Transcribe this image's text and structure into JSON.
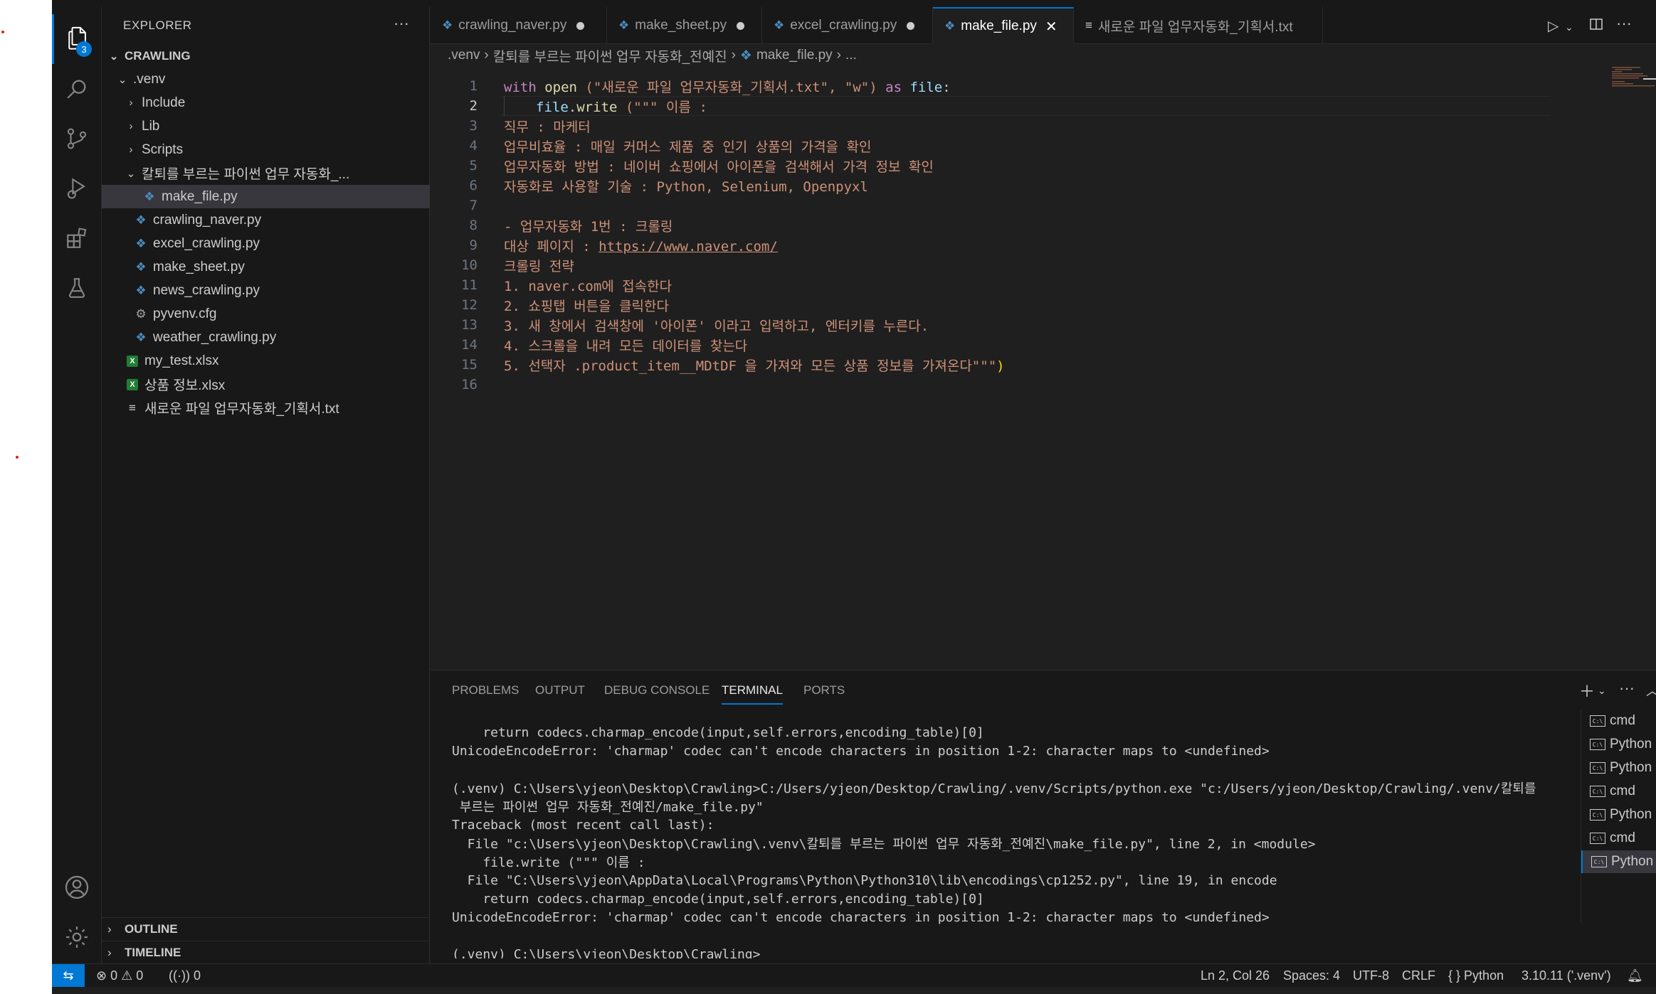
{
  "colors": {
    "accent": "#0078d4",
    "string": "#ce9178",
    "keyword": "#c586c0",
    "function": "#dcdcaa",
    "variable": "#9cdcfe"
  },
  "activity": {
    "explorer_icon": "files-icon",
    "explorer_badge": "3",
    "search_icon": "search-icon",
    "scm_icon": "source-control-icon",
    "debug_icon": "run-debug-icon",
    "extensions_icon": "extensions-icon",
    "testing_icon": "testing-flask-icon",
    "account_icon": "account-icon",
    "settings_icon": "gear-icon"
  },
  "sidebar": {
    "title": "EXPLORER",
    "more": "···",
    "root": "CRAWLING",
    "tree": [
      {
        "label": ".venv",
        "type": "folder-open"
      },
      {
        "label": "Include",
        "type": "folder"
      },
      {
        "label": "Lib",
        "type": "folder"
      },
      {
        "label": "Scripts",
        "type": "folder"
      },
      {
        "label": "칼퇴를 부르는 파이썬 업무 자동화_...",
        "type": "folder-open"
      },
      {
        "label": "make_file.py",
        "type": "python"
      },
      {
        "label": "crawling_naver.py",
        "type": "python"
      },
      {
        "label": "excel_crawling.py",
        "type": "python"
      },
      {
        "label": "make_sheet.py",
        "type": "python"
      },
      {
        "label": "news_crawling.py",
        "type": "python"
      },
      {
        "label": "pyvenv.cfg",
        "type": "config"
      },
      {
        "label": "weather_crawling.py",
        "type": "python"
      },
      {
        "label": "my_test.xlsx",
        "type": "excel"
      },
      {
        "label": "상품 정보.xlsx",
        "type": "excel"
      },
      {
        "label": "새로운 파일 업무자동화_기획서.txt",
        "type": "text"
      }
    ],
    "outline": "OUTLINE",
    "timeline": "TIMELINE"
  },
  "tabs": [
    {
      "label": "crawling_naver.py",
      "state": "modified"
    },
    {
      "label": "make_sheet.py",
      "state": "modified"
    },
    {
      "label": "excel_crawling.py",
      "state": "modified"
    },
    {
      "label": "make_file.py",
      "state": "active"
    },
    {
      "label": "새로운 파일 업무자동화_기획서.txt",
      "state": "normal"
    }
  ],
  "breadcrumb": [
    ".venv",
    "칼퇴를 부르는 파이썬 업무 자동화_전예진",
    "make_file.py",
    "..."
  ],
  "editor": {
    "current_line": 2,
    "lines": [
      {
        "n": "1"
      },
      {
        "n": "2"
      },
      {
        "n": "3"
      },
      {
        "n": "4"
      },
      {
        "n": "5"
      },
      {
        "n": "6"
      },
      {
        "n": "7"
      },
      {
        "n": "8"
      },
      {
        "n": "9"
      },
      {
        "n": "10"
      },
      {
        "n": "11"
      },
      {
        "n": "12"
      },
      {
        "n": "13"
      },
      {
        "n": "14"
      },
      {
        "n": "15"
      },
      {
        "n": "16"
      }
    ],
    "l1": {
      "with": "with",
      "open": "open",
      "args1": " (\"새로운 파일 업무자동화_기획서.txt\", \"w\") ",
      "as": "as",
      "file": "file",
      "colon": ":"
    },
    "l2": {
      "file": "file",
      "dot": ".",
      "write": "write",
      "rest": " (\"\"\" 이름 :"
    },
    "l3": "직무 : 마케터",
    "l4": "업무비효율 : 매일 커머스 제품 중 인기 상품의 가격을 확인",
    "l5": "업무자동화 방법 : 네이버 쇼핑에서 아이폰을 검색해서 가격 정보 확인",
    "l6": "자동화로 사용할 기술 : Python, Selenium, Openpyxl",
    "l7": "",
    "l8": "- 업무자동화 1번 : 크롤링",
    "l9_prefix": "대상 페이지 : ",
    "l9_link": "https://www.naver.com/",
    "l10": "크롤링 전략",
    "l11": "1. naver.com에 접속한다",
    "l12": "2. 쇼핑탭 버튼을 클릭한다",
    "l13": "3. 새 창에서 검색창에 '아이폰' 이라고 입력하고, 엔터키를 누른다.",
    "l14": "4. 스크롤을 내려 모든 데이터를 찾는다",
    "l15_str": "5. 선택자 .product_item__MDtDF 을 가져와 모든 상품 정보를 가져온다\"\"\"",
    "l15_end": ")",
    "l16": ""
  },
  "panel": {
    "tabs": [
      "PROBLEMS",
      "OUTPUT",
      "DEBUG CONSOLE",
      "TERMINAL",
      "PORTS"
    ],
    "active_tab": "TERMINAL",
    "terminal_lines": [
      "    return codecs.charmap_encode(input,self.errors,encoding_table)[0]",
      "UnicodeEncodeError: 'charmap' codec can't encode characters in position 1-2: character maps to <undefined>",
      "",
      "(.venv) C:\\Users\\yjeon\\Desktop\\Crawling>C:/Users/yjeon/Desktop/Crawling/.venv/Scripts/python.exe \"c:/Users/yjeon/Desktop/Crawling/.venv/칼퇴를",
      " 부르는 파이썬 업무 자동화_전예진/make_file.py\"",
      "Traceback (most recent call last):",
      "  File \"c:\\Users\\yjeon\\Desktop\\Crawling\\.venv\\칼퇴를 부르는 파이썬 업무 자동화_전예진\\make_file.py\", line 2, in <module>",
      "    file.write (\"\"\" 이름 :",
      "  File \"C:\\Users\\yjeon\\AppData\\Local\\Programs\\Python\\Python310\\lib\\encodings\\cp1252.py\", line 19, in encode",
      "    return codecs.charmap_encode(input,self.errors,encoding_table)[0]",
      "UnicodeEncodeError: 'charmap' codec can't encode characters in position 1-2: character maps to <undefined>",
      "",
      "(.venv) C:\\Users\\yjeon\\Desktop\\Crawling>"
    ],
    "terminals": [
      {
        "label": "cmd",
        "selected": false
      },
      {
        "label": "Python",
        "selected": false
      },
      {
        "label": "Python",
        "selected": false
      },
      {
        "label": "cmd",
        "selected": false
      },
      {
        "label": "Python",
        "selected": false
      },
      {
        "label": "cmd",
        "selected": false
      },
      {
        "label": "Python",
        "selected": true
      }
    ]
  },
  "status": {
    "errors": "0",
    "warnings": "0",
    "ports": "0",
    "position": "Ln 2, Col 26",
    "spaces": "Spaces: 4",
    "encoding": "UTF-8",
    "eol": "CRLF",
    "language": "Python",
    "interpreter": "3.10.11 ('.venv')"
  }
}
